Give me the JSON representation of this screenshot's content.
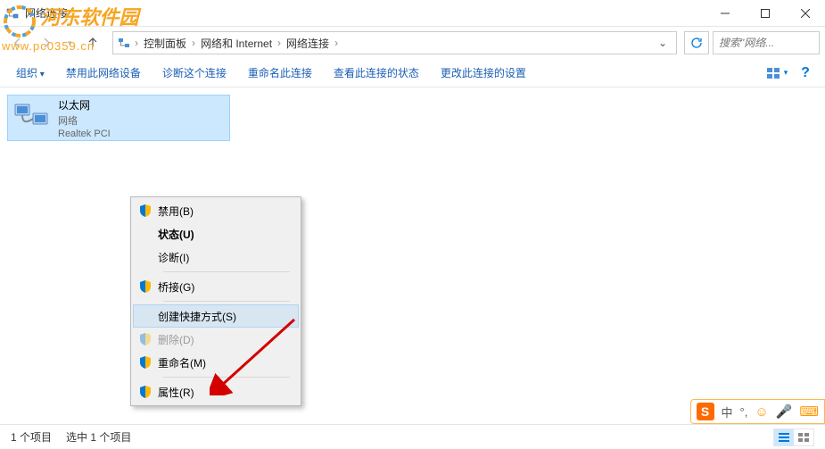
{
  "window": {
    "title": "网络连接"
  },
  "watermark": {
    "text": "河东软件园",
    "url": "www.pc0359.cn"
  },
  "breadcrumb": {
    "items": [
      "控制面板",
      "网络和 Internet",
      "网络连接"
    ]
  },
  "search": {
    "placeholder": "搜索\"网络..."
  },
  "toolbar": {
    "organize": "组织",
    "disable_device": "禁用此网络设备",
    "diagnose": "诊断这个连接",
    "rename": "重命名此连接",
    "view_status": "查看此连接的状态",
    "change_settings": "更改此连接的设置"
  },
  "connection": {
    "name": "以太网",
    "status": "网络",
    "device": "Realtek PCI"
  },
  "menu": {
    "disable": "禁用(B)",
    "status": "状态(U)",
    "diagnose": "诊断(I)",
    "bridge": "桥接(G)",
    "shortcut": "创建快捷方式(S)",
    "delete": "删除(D)",
    "rename": "重命名(M)",
    "properties": "属性(R)"
  },
  "statusbar": {
    "count": "1 个项目",
    "selected": "选中 1 个项目"
  },
  "ime": {
    "logo": "S",
    "text": "中"
  }
}
